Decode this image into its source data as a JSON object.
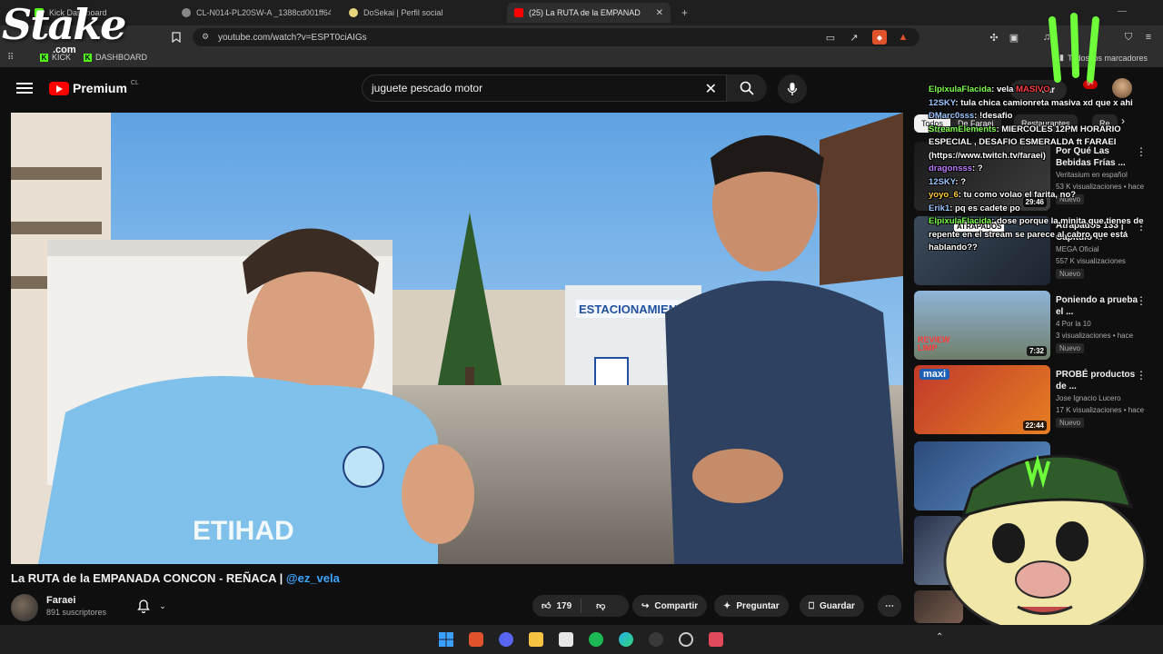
{
  "browser": {
    "tabs": [
      {
        "label": "Kick Dashboard",
        "active": false
      },
      {
        "label": "CL-N014-PL20SW-A _1388cd001ff64",
        "active": false
      },
      {
        "label": "DoSekai | Perfil social",
        "active": false
      },
      {
        "label": "(25) La RUTA de la EMPANAD",
        "active": true
      }
    ],
    "new_tab": "+",
    "url": "youtube.com/watch?v=ESPT0ciAIGs",
    "bookmarks": [
      {
        "label": "KICK"
      },
      {
        "label": "DASHBOARD"
      }
    ],
    "bookmarks_right": "Todos los marcadores"
  },
  "youtube": {
    "brand": "Premium",
    "region": "CL",
    "search_query": "juguete pescado motor",
    "create_label": "Crear",
    "notifications": "9+",
    "video": {
      "title": "La RUTA de la EMPANADA CONCON - REÑACA |",
      "mention": "@ez_vela",
      "scene_sign": "ESTACIONAMIENTO",
      "shirt_text": "ETIHAD"
    },
    "channel": {
      "name": "Faraei",
      "subscribers": "891 suscriptores"
    },
    "actions": {
      "likes": "179",
      "share": "Compartir",
      "ask": "Preguntar",
      "save": "Guardar",
      "more": "⋯"
    },
    "chips": [
      "Todos",
      "De Faraei",
      "Restaurantes",
      "Re"
    ],
    "recommendations": [
      {
        "title": "Por Qué Las Bebidas Frías ...",
        "channel": "Veritasium en español",
        "views": "53 K visualizaciones • hace",
        "badge": "Nuevo",
        "duration": "29:46"
      },
      {
        "title": "Atrapados 133 | Capítulo ...",
        "channel": "MEGA Oficial",
        "views": "557 K visualizaciones",
        "badge": "Nuevo",
        "duration": "",
        "thumb_text": "ATRAPADOS"
      },
      {
        "title": "Poniendo a prueba el ...",
        "channel": "4 Por la 10",
        "views": "3 visualizaciones • hace",
        "badge": "Nuevo",
        "duration": "7:32",
        "thumb_text": "REVIEW LIMP"
      },
      {
        "title": "PROBÉ productos de ...",
        "channel": "Jose Ignacio Lucero",
        "views": "17 K visualizaciones • hace",
        "badge": "Nuevo",
        "duration": "22:44",
        "thumb_text": "maxi"
      }
    ]
  },
  "chat": [
    {
      "user": "ElpixulaFlacida",
      "msg": ": vela",
      "badge": "MASIVO"
    },
    {
      "user": "12SKY",
      "msg": ": tula chica camionreta masiva xd que x ahi"
    },
    {
      "user": "DMarc0sss",
      "msg": ": !desafio"
    },
    {
      "user": "StreamElements",
      "msg": ": MIERCOLES 12PM HORARIO ESPECIAL , DESAFIO ESMERALDA ft FARAEI (https://www.twitch.tv/faraei)"
    },
    {
      "user": "dragonsss",
      "msg": ": ?"
    },
    {
      "user": "12SKY",
      "msg": ": ?"
    },
    {
      "user": "yoyo_6",
      "msg": ": tu como volao el farita, no?"
    },
    {
      "user": "Erik1",
      "msg": ": pq es cadete po"
    },
    {
      "user": "ElpixulaFlacida",
      "msg": ": dose porque la minita que tienes de repente en el stream se parece al cabro que está hablando??"
    }
  ],
  "overlay": {
    "stake": "Stake",
    "stake_com": ".com"
  },
  "colors": {
    "bg": "#0f0f0f",
    "accent_red": "#ff0000",
    "link_blue": "#3ea6ff",
    "kick_green": "#53fc18"
  }
}
